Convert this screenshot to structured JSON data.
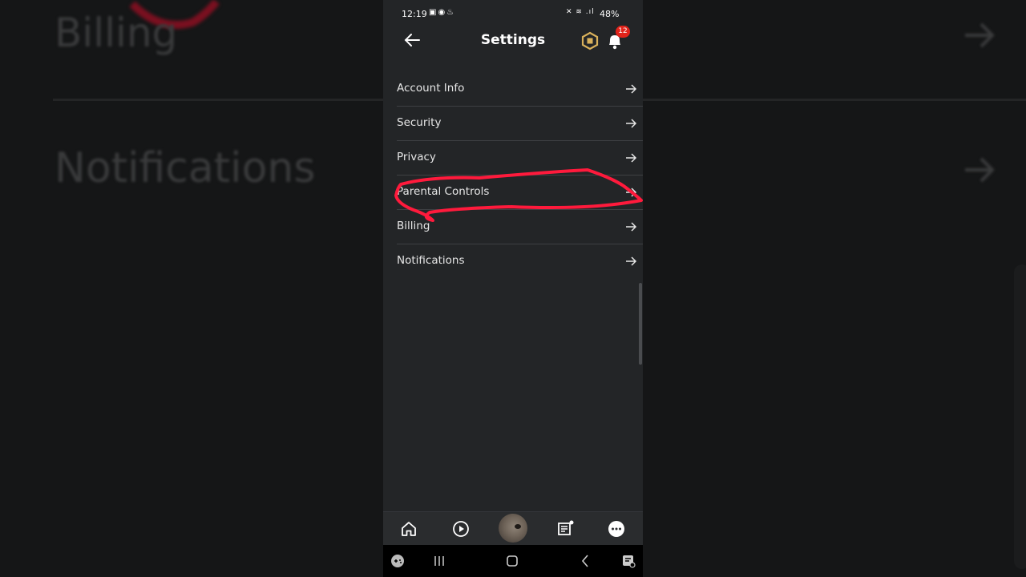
{
  "background": {
    "billing_text": "Billing",
    "notifications_text": "Notifications"
  },
  "status_bar": {
    "time": "12:19",
    "battery": "48%"
  },
  "header": {
    "title": "Settings",
    "notification_count": "12"
  },
  "menu": {
    "items": [
      {
        "label": "Account Info"
      },
      {
        "label": "Security"
      },
      {
        "label": "Privacy"
      },
      {
        "label": "Parental Controls"
      },
      {
        "label": "Billing"
      },
      {
        "label": "Notifications"
      }
    ]
  },
  "bottom_nav": {
    "items": [
      "home-icon",
      "play-icon",
      "avatar",
      "chat-icon",
      "more-icon"
    ]
  },
  "colors": {
    "annotation_red": "#ff1a3c",
    "badge_red": "#e2231a",
    "robux_gold": "#d9b15b",
    "panel_bg": "#232527"
  }
}
